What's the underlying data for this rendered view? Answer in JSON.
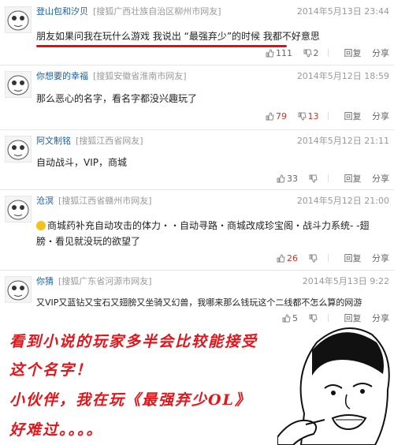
{
  "comments": [
    {
      "user": "登山包和汐贝",
      "location": "[搜狐广西壮族自治区柳州市网友]",
      "time": "2014年5月13日 23:44",
      "text": "朋友如果问我在玩什么游戏  我说出  “最强弃少”的时候  我都不好意思",
      "likes": "111",
      "dislikes": "2",
      "reply": "回复",
      "share": "分享"
    },
    {
      "user": "你想要的幸福",
      "location": "[搜狐安徽省淮南市网友]",
      "time": "2014年5月12日 18:59",
      "text": "那么恶心的名字，看名字都没兴趣玩了",
      "likes": "79",
      "dislikes": "13",
      "reply": "回复",
      "share": "分享"
    },
    {
      "user": "阿文制铭",
      "location": "[搜狐江西省网友]",
      "time": "2014年5月12日 21:11",
      "text": "自动战斗，VIP，商城",
      "likes": "33",
      "dislikes": "",
      "reply": "回复",
      "share": "分享"
    },
    {
      "user": "沧溟",
      "location": "[搜狐江西省赣州市网友]",
      "time": "2014年5月12日 21:00",
      "text": "商城药补充自动攻击的体力・・自动寻路・商城改成珍宝阁・战斗力系统- -翅膀・看见就没玩的欲望了",
      "likes": "26",
      "dislikes": "",
      "reply": "回复",
      "share": "分享"
    },
    {
      "user": "你猜",
      "location": "[搜狐广东省河源市网友]",
      "time": "2014年5月13日 9:22",
      "text": "又VIP又蓝钻又宝石又翅膀又坐骑又幻兽，我哪来那么钱玩这个二线都不怎么算的网游",
      "likes": "5",
      "dislikes": "",
      "reply": "回复",
      "share": "分享"
    }
  ],
  "caption": {
    "line1": "看到小说的玩家多半会比较能接受",
    "line2": "这个名字！",
    "line3": "小伙伴，我在玩《最强弃少OL》",
    "line4": "好难过。。。。"
  },
  "colors": {
    "accent_red": "#d4141a",
    "caption_red": "#e3141a",
    "username_blue": "#1a5fa8"
  }
}
